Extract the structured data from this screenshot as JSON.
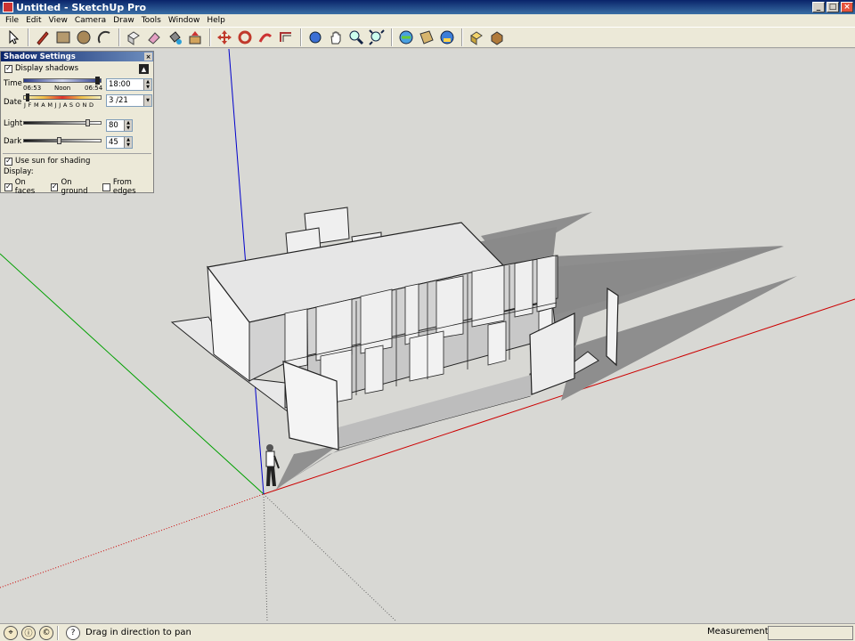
{
  "window": {
    "title": "Untitled - SketchUp Pro"
  },
  "menu": [
    "File",
    "Edit",
    "View",
    "Camera",
    "Draw",
    "Tools",
    "Window",
    "Help"
  ],
  "toolbar": {
    "tools": [
      "select",
      "pencil",
      "rectangle",
      "circle",
      "arc",
      "make-component",
      "eraser",
      "paint-bucket",
      "push-pull",
      "move",
      "rotate",
      "follow-me",
      "offset",
      "orbit",
      "pan",
      "zoom",
      "zoom-extents",
      "get-models",
      "share-model",
      "get-photo-texture",
      "components",
      "materials"
    ]
  },
  "shadow_panel": {
    "title": "Shadow Settings",
    "display_shadows_label": "Display shadows",
    "display_shadows_checked": true,
    "time_label": "Time",
    "time_sunrise": "06:53",
    "time_noon": "Noon",
    "time_sunset": "06:54",
    "time_value": "18:00",
    "date_label": "Date",
    "months": "J F M A M J J A S O N D",
    "date_value": "3 /21",
    "light_label": "Light",
    "light_value": "80",
    "dark_label": "Dark",
    "dark_value": "45",
    "use_sun_label": "Use sun for shading",
    "use_sun_checked": true,
    "display_label": "Display:",
    "on_faces_label": "On faces",
    "on_faces_checked": true,
    "on_ground_label": "On ground",
    "on_ground_checked": true,
    "from_edges_label": "From edges",
    "from_edges_checked": false
  },
  "status": {
    "hint": "Drag in direction to pan",
    "measurements_label": "Measurements",
    "measurements_value": ""
  },
  "colors": {
    "axis_red": "#cc0000",
    "axis_green": "#00a000",
    "axis_blue": "#0000cc",
    "shadow": "#8e8e8e",
    "sky_ground": "#d8d8d4"
  }
}
